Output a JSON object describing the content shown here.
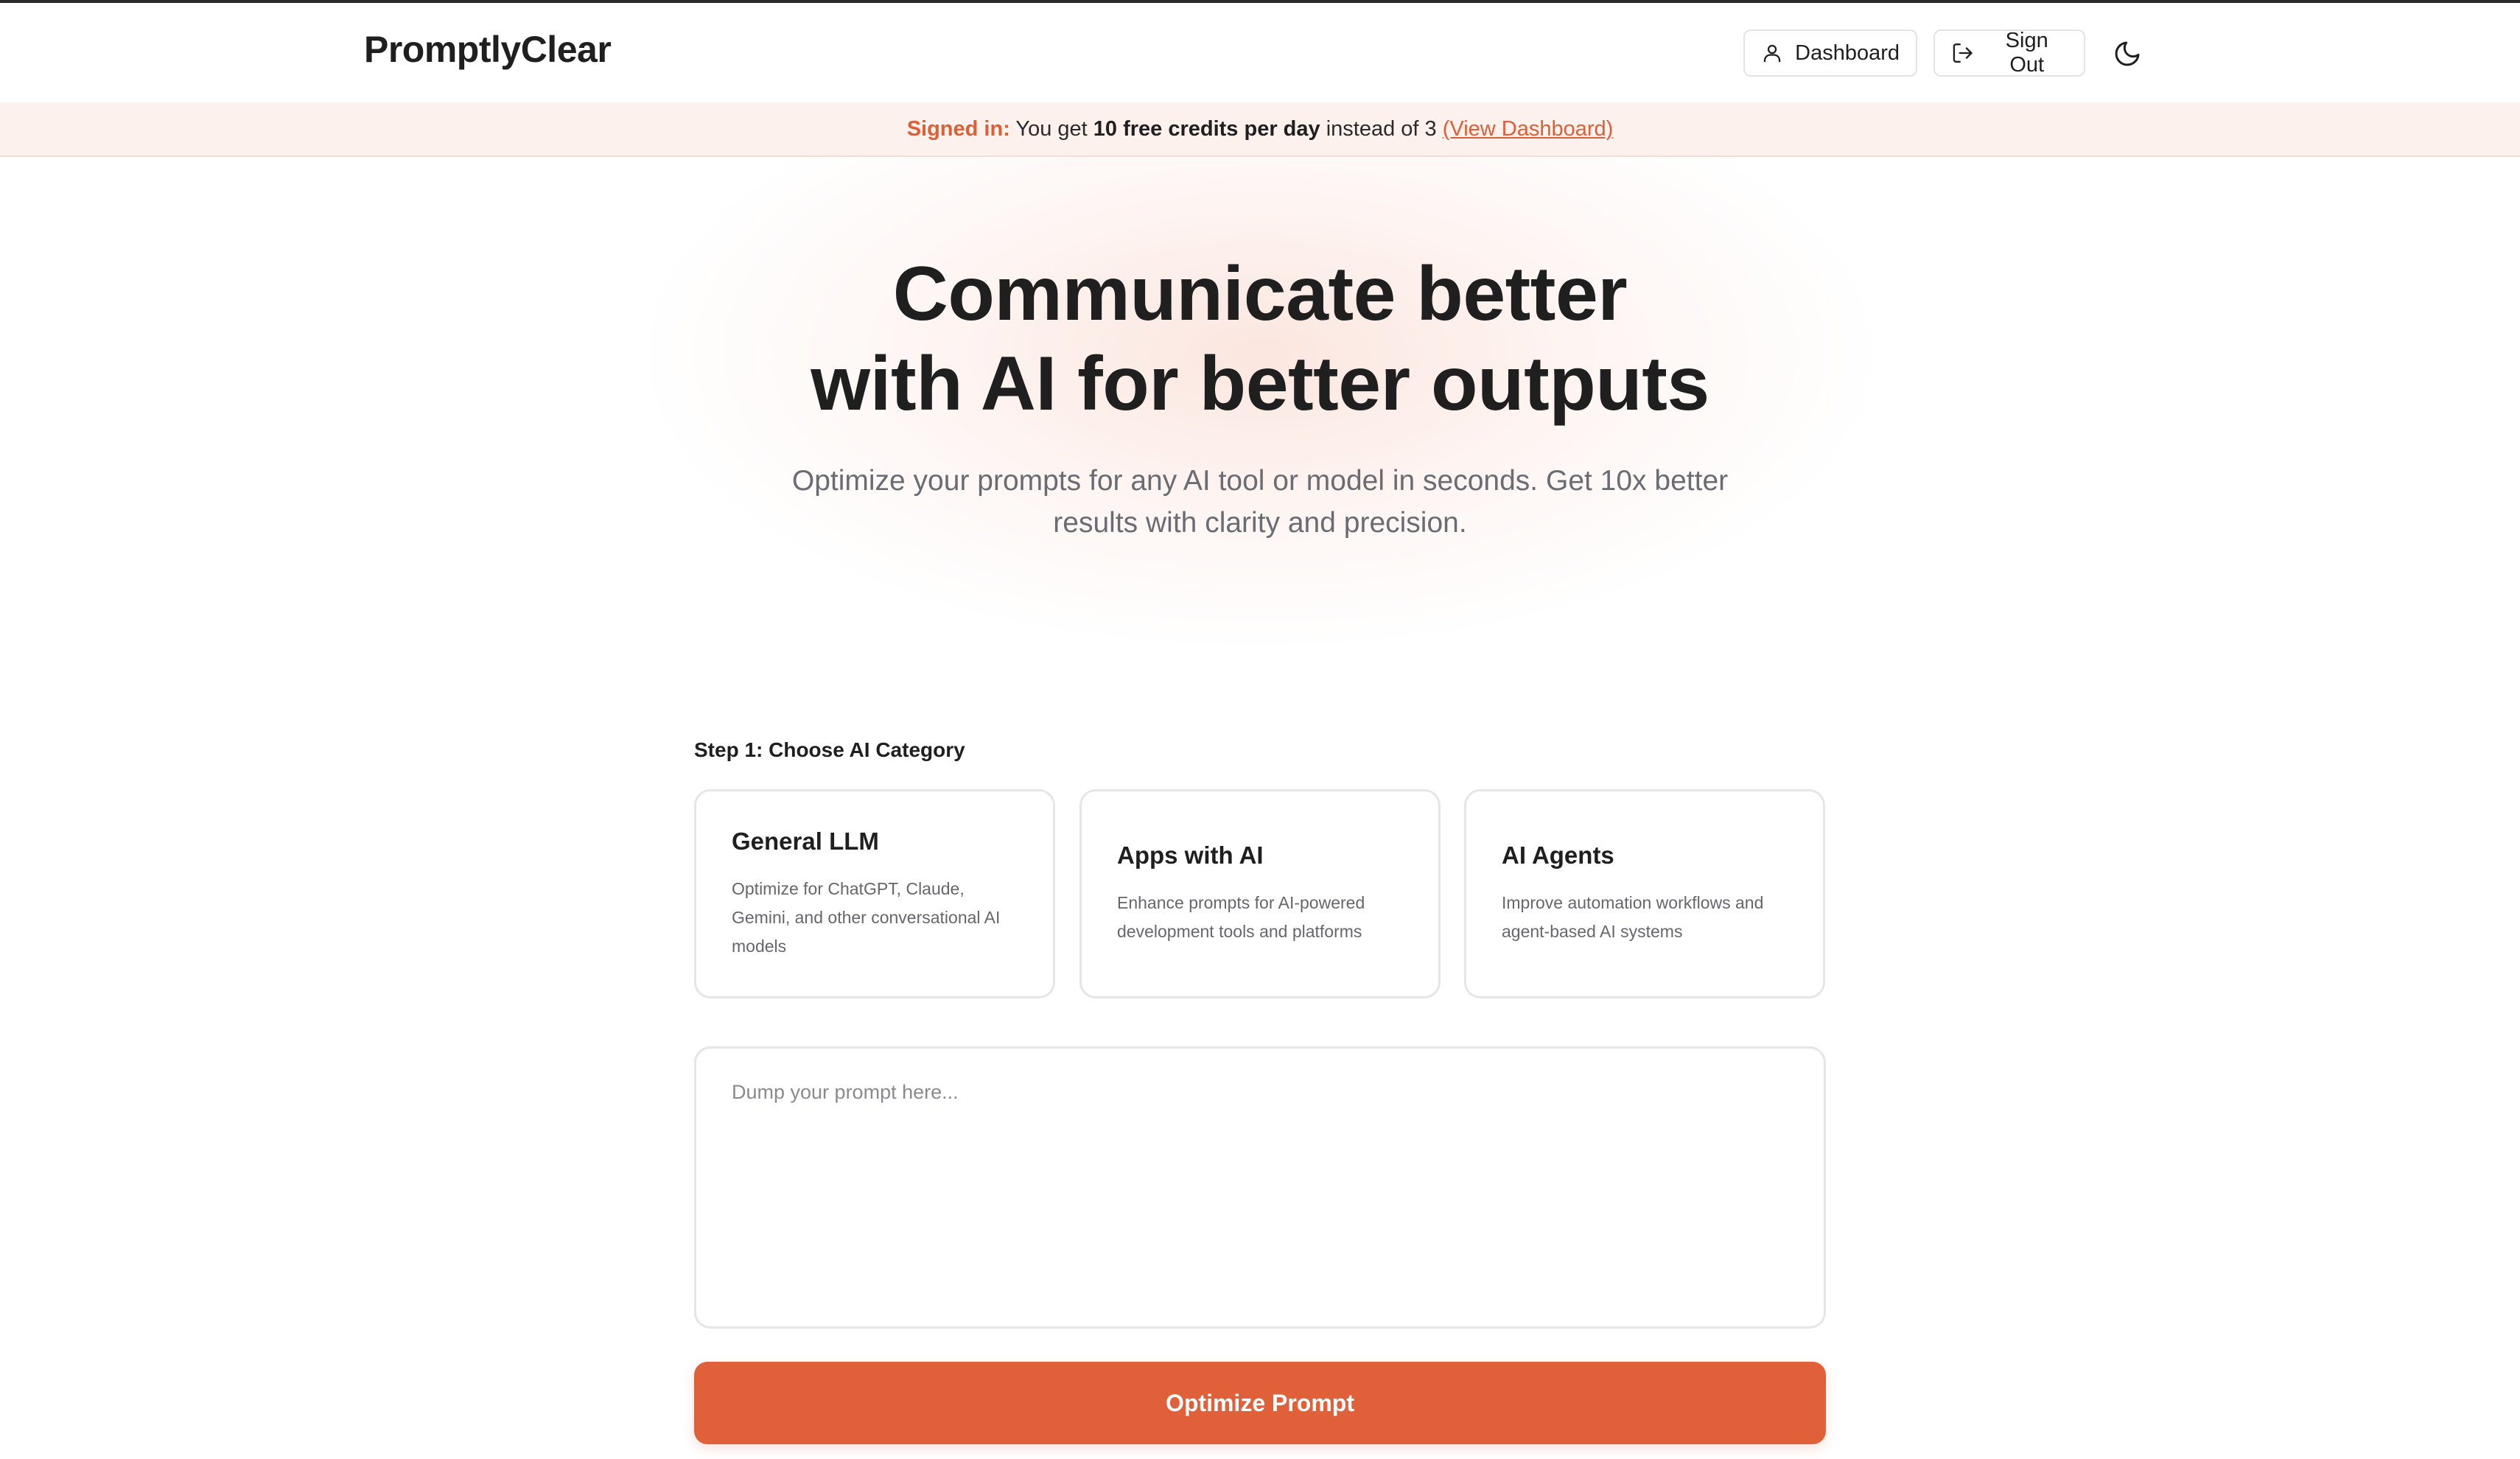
{
  "header": {
    "logo": "PromptlyClear",
    "dashboard_label": "Dashboard",
    "signout_label": "Sign Out",
    "dashboard_icon": "user-icon",
    "signout_icon": "log-out-icon",
    "theme_icon": "moon-icon"
  },
  "banner": {
    "signed_in": "Signed in:",
    "text_1": " You get ",
    "credits": "10 free credits per day",
    "text_2": " instead of 3 ",
    "link": "(View Dashboard)"
  },
  "hero": {
    "title_line1": "Communicate better",
    "title_line2": "with AI for better outputs",
    "subtitle_line1": "Optimize your prompts for any AI tool or model in seconds. Get 10x better",
    "subtitle_line2": "results with clarity and precision."
  },
  "step": {
    "label": "Step 1: Choose AI Category",
    "cards": [
      {
        "title": "General LLM",
        "desc": "Optimize for ChatGPT, Claude, Gemini, and other conversational AI models"
      },
      {
        "title": "Apps with AI",
        "desc": "Enhance prompts for AI-powered development tools and platforms"
      },
      {
        "title": "AI Agents",
        "desc": "Improve automation workflows and agent-based AI systems"
      }
    ]
  },
  "prompt": {
    "placeholder": "Dump your prompt here...",
    "value": ""
  },
  "optimize_label": "Optimize Prompt",
  "colors": {
    "accent": "#e0603a",
    "banner_bg": "#fdf1ee",
    "text": "#1f1f1f",
    "muted": "#6b6b72"
  }
}
